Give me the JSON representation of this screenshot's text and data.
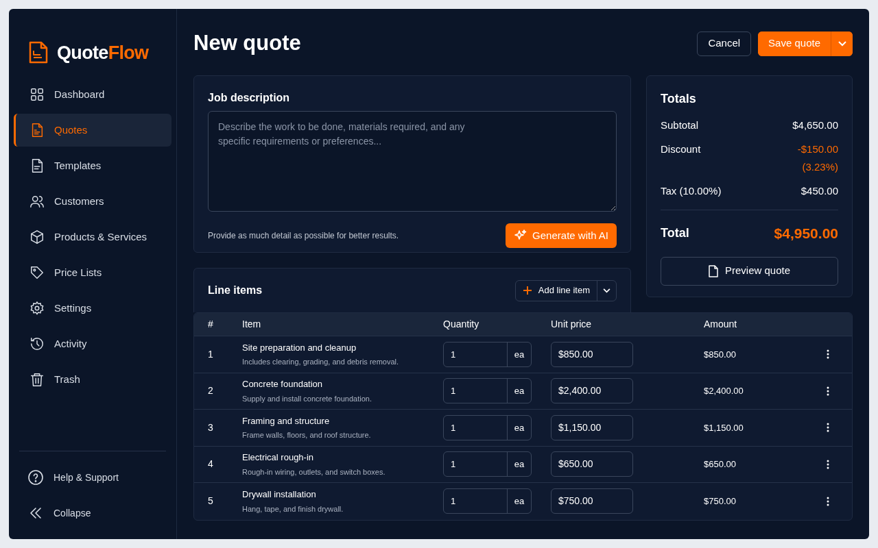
{
  "brand": {
    "part_1": "Quote",
    "part_2": "Flow"
  },
  "sidebar": {
    "items": [
      {
        "label": "Dashboard",
        "selected": false
      },
      {
        "label": "Quotes",
        "selected": true
      },
      {
        "label": "Templates",
        "selected": false
      },
      {
        "label": "Customers",
        "selected": false
      },
      {
        "label": "Products & Services",
        "selected": false
      },
      {
        "label": "Price Lists",
        "selected": false
      },
      {
        "label": "Settings",
        "selected": false
      },
      {
        "label": "Activity",
        "selected": false
      },
      {
        "label": "Trash",
        "selected": false
      }
    ],
    "footer_items": [
      "Help & Support",
      "Collapse"
    ]
  },
  "page_title": "New quote",
  "header_buttons": {
    "cancel": "Cancel",
    "save": "Save quote"
  },
  "job_description": {
    "title": "Job description",
    "placeholder": "Describe the work to be done, materials required, and any specific requirements or preferences...",
    "hint": "Provide as much detail as possible for better results.",
    "button": "Generate with AI"
  },
  "totals": {
    "title": "Totals",
    "rows": [
      {
        "label": "Subtotal",
        "value": "$4,650.00",
        "kind": "plain"
      },
      {
        "label": "Discount",
        "value": "-$150.00",
        "note": "(3.23%)",
        "kind": "discount"
      },
      {
        "label": "Tax (10.00%)",
        "value": "$450.00",
        "kind": "plain"
      }
    ],
    "total_label": "Total",
    "total_value": "$4,950.00",
    "preview_button": "Preview quote"
  },
  "line_items": {
    "title": "Line items",
    "add_button": "Add line item",
    "columns": [
      "#",
      "Item",
      "Quantity",
      "Unit price",
      "Amount"
    ],
    "rows": [
      {
        "number": "1",
        "name": "Site preparation and cleanup",
        "description": "Includes clearing, grading, and debris removal.",
        "quantity": "1",
        "unit": "ea",
        "unit_price": "$850.00",
        "amount": "$850.00"
      },
      {
        "number": "2",
        "name": "Concrete foundation",
        "description": "Supply and install concrete foundation.",
        "quantity": "1",
        "unit": "ea",
        "unit_price": "$2,400.00",
        "amount": "$2,400.00"
      },
      {
        "number": "3",
        "name": "Framing and structure",
        "description": "Frame walls, floors, and roof structure.",
        "quantity": "1",
        "unit": "ea",
        "unit_price": "$1,150.00",
        "amount": "$1,150.00"
      },
      {
        "number": "4",
        "name": "Electrical rough-in",
        "description": "Rough-in wiring, outlets, and switch boxes.",
        "quantity": "1",
        "unit": "ea",
        "unit_price": "$650.00",
        "amount": "$650.00"
      },
      {
        "number": "5",
        "name": "Drywall installation",
        "description": "Hang, tape, and finish drywall.",
        "quantity": "1",
        "unit": "ea",
        "unit_price": "$750.00",
        "amount": "$750.00"
      }
    ]
  }
}
